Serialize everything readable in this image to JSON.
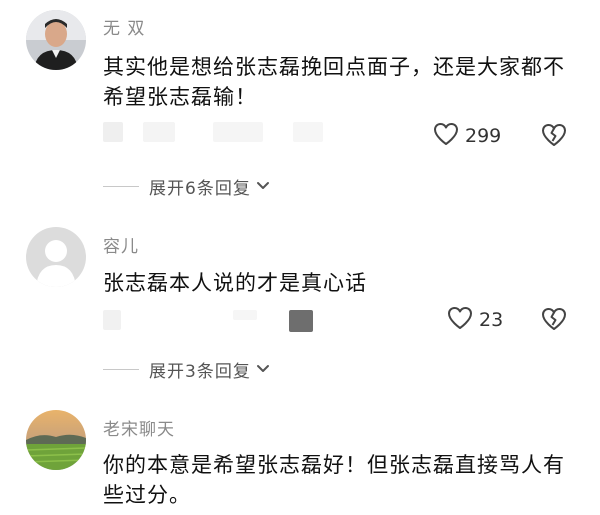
{
  "comments": [
    {
      "username": "无 双",
      "text": "其实他是想给张志磊挽回点面子，还是大家都不希望张志磊输！",
      "likes": "299",
      "expand_label": "展开6条回复",
      "avatar": "man-photo"
    },
    {
      "username": "容儿",
      "text": "张志磊本人说的才是真心话",
      "likes": "23",
      "expand_label": "展开3条回复",
      "avatar": "default-gray-person"
    },
    {
      "username": "老宋聊天",
      "text": "你的本意是希望张志磊好！但张志磊直接骂人有些过分。",
      "avatar": "landscape-photo"
    }
  ],
  "icons": {
    "like": "heart-outline-icon",
    "dislike": "broken-heart-icon",
    "expand": "chevron-down-icon"
  },
  "colors": {
    "username": "#8a8a8a",
    "text": "#111111",
    "muted": "#555555"
  }
}
